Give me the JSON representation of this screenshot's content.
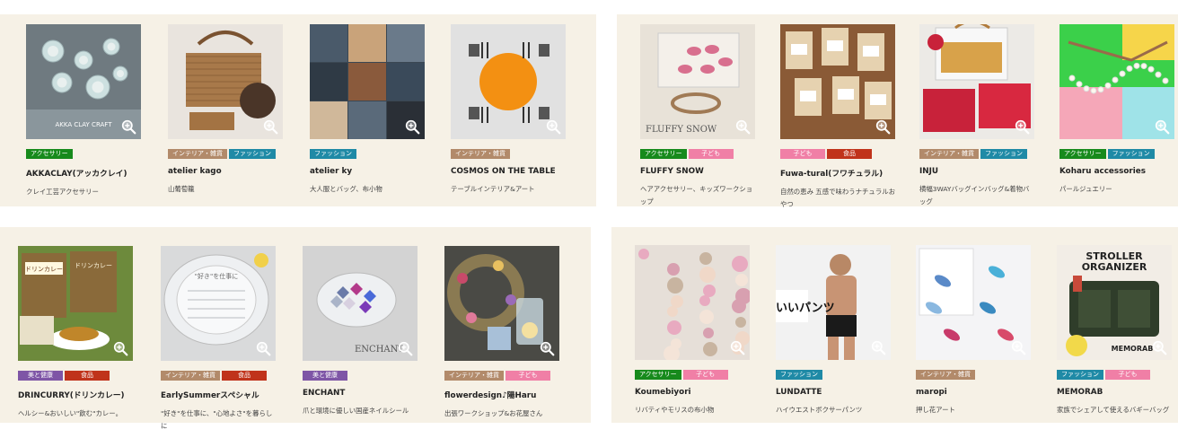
{
  "colors": {
    "panel_bg": "#f6f1e6",
    "tag_accessory": "#178a1c",
    "tag_interior": "#b28a6a",
    "tag_fashion": "#1f8aa6",
    "tag_kids": "#f07fa6",
    "tag_food": "#c0331b",
    "tag_beauty": "#7e55a6"
  },
  "icons": {
    "thumbnail_overlay": "zoom-in-icon"
  },
  "panels": [
    {
      "items": [
        {
          "name": "AKKACLAY(アッカクレイ)",
          "description": "クレイ工芸アクセサリー",
          "tags": [
            {
              "label": "アクセサリー",
              "color": "#178a1c"
            }
          ],
          "image": {
            "bg": "#6f7a80",
            "motif": "clay",
            "caption": "AKKA CLAY CRAFT"
          }
        },
        {
          "name": "atelier kago",
          "description": "山葡萄籠",
          "tags": [
            {
              "label": "インテリア・雑貨",
              "color": "#b28a6a"
            },
            {
              "label": "ファッション",
              "color": "#1f8aa6"
            }
          ],
          "image": {
            "bg": "#e9e4de",
            "motif": "basket",
            "caption": ""
          }
        },
        {
          "name": "atelier ky",
          "description": "大人服とバッグ、布小物",
          "tags": [
            {
              "label": "ファッション",
              "color": "#1f8aa6"
            }
          ],
          "image": {
            "bg": "#3b4752",
            "motif": "grid",
            "caption": ""
          }
        },
        {
          "name": "COSMOS ON THE TABLE",
          "description": "テーブルインテリア&アート",
          "tags": [
            {
              "label": "インテリア・雑貨",
              "color": "#b28a6a"
            }
          ],
          "image": {
            "bg": "#e1e1e1",
            "motif": "orange",
            "caption": ""
          }
        }
      ]
    },
    {
      "items": [
        {
          "name": "FLUFFY SNOW",
          "description": "ヘアアクセサリー、キッズワークショップ",
          "tags": [
            {
              "label": "アクセサリー",
              "color": "#178a1c"
            },
            {
              "label": "子ども",
              "color": "#f07fa6"
            }
          ],
          "image": {
            "bg": "#e8e2d8",
            "motif": "fabric",
            "caption": "FLUFFY SNOW"
          }
        },
        {
          "name": "Fuwa-tural(フワチュラル)",
          "description": "自然の恵み 五感で味わうナチュラルおやつ",
          "tags": [
            {
              "label": "子ども",
              "color": "#f07fa6"
            },
            {
              "label": "食品",
              "color": "#c0331b"
            }
          ],
          "image": {
            "bg": "#8a5a36",
            "motif": "bags",
            "caption": ""
          }
        },
        {
          "name": "INJU",
          "description": "横幅3WAYバッグインバッグ&着物バッグ",
          "tags": [
            {
              "label": "インテリア・雑貨",
              "color": "#b28a6a"
            },
            {
              "label": "ファッション",
              "color": "#1f8aa6"
            }
          ],
          "image": {
            "bg": "#eceae6",
            "motif": "redbags",
            "caption": ""
          }
        },
        {
          "name": "Koharu accessories",
          "description": "パールジュエリー",
          "tags": [
            {
              "label": "アクセサリー",
              "color": "#178a1c"
            },
            {
              "label": "ファッション",
              "color": "#1f8aa6"
            }
          ],
          "image": {
            "bg": "#3bd04a",
            "motif": "pearls",
            "caption": ""
          }
        }
      ]
    },
    {
      "items": [
        {
          "name": "DRINCURRY(ドリンカレー)",
          "description": "ヘルシー&おいしい\"飲む\"カレー。",
          "tags": [
            {
              "label": "美と健康",
              "color": "#7e55a6"
            },
            {
              "label": "食品",
              "color": "#c0331b"
            }
          ],
          "image": {
            "bg": "#6d8a3c",
            "motif": "curry",
            "caption": "ドリンカレー"
          }
        },
        {
          "name": "EarlySummerスペシャル",
          "description": "\"好き\"を仕事に、\"心地よさ\"を暮らしに",
          "tags": [
            {
              "label": "インテリア・雑貨",
              "color": "#b28a6a"
            },
            {
              "label": "食品",
              "color": "#c0331b"
            }
          ],
          "image": {
            "bg": "#d9dadb",
            "motif": "plate",
            "caption": "\"好き\"を仕事に"
          }
        },
        {
          "name": "ENCHANT",
          "description": "爪と環境に優しい国産ネイルシール",
          "tags": [
            {
              "label": "美と健康",
              "color": "#7e55a6"
            }
          ],
          "image": {
            "bg": "#d3d3d3",
            "motif": "gems",
            "caption": "ENCHANT"
          }
        },
        {
          "name": "flowerdesign♪陽Haru",
          "description": "出張ワークショップ&お花屋さん",
          "tags": [
            {
              "label": "インテリア・雑貨",
              "color": "#b28a6a"
            },
            {
              "label": "子ども",
              "color": "#f07fa6"
            }
          ],
          "image": {
            "bg": "#4a4a45",
            "motif": "wreath",
            "caption": ""
          }
        }
      ]
    },
    {
      "items": [
        {
          "name": "Koumebiyori",
          "description": "リバティやモリスの布小物",
          "tags": [
            {
              "label": "アクセサリー",
              "color": "#178a1c"
            },
            {
              "label": "子ども",
              "color": "#f07fa6"
            }
          ],
          "image": {
            "bg": "#e6dfd8",
            "motif": "flowers",
            "caption": ""
          }
        },
        {
          "name": "LUNDATTE",
          "description": "ハイウエストボクサーパンツ",
          "tags": [
            {
              "label": "ファッション",
              "color": "#1f8aa6"
            }
          ],
          "image": {
            "bg": "#f2f2f2",
            "motif": "model",
            "caption": "いいパンツ"
          }
        },
        {
          "name": "maropi",
          "description": "押し花アート",
          "tags": [
            {
              "label": "インテリア・雑貨",
              "color": "#b28a6a"
            }
          ],
          "image": {
            "bg": "#f4f4f6",
            "motif": "petals",
            "caption": ""
          }
        },
        {
          "name": "MEMORAB",
          "description": "家族でシェアして使えるバギーバッグ",
          "tags": [
            {
              "label": "ファッション",
              "color": "#1f8aa6"
            },
            {
              "label": "子ども",
              "color": "#f07fa6"
            }
          ],
          "image": {
            "bg": "#f2ede6",
            "motif": "organizer",
            "caption": "STROLLER ORGANIZER"
          }
        }
      ]
    }
  ]
}
